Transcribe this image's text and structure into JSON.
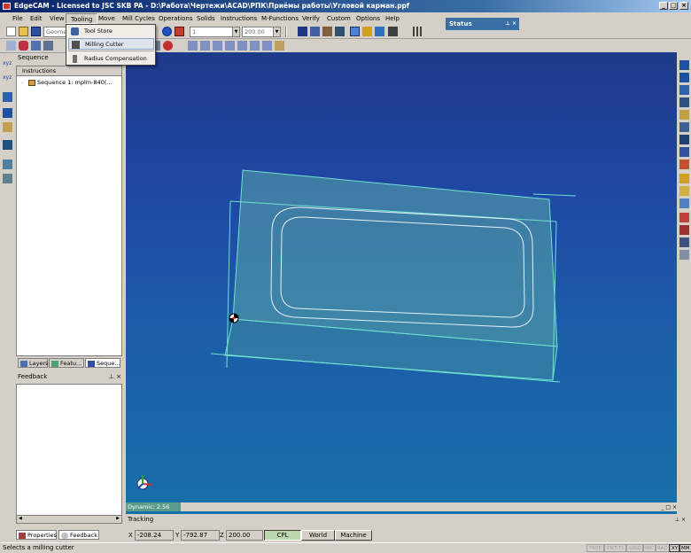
{
  "window": {
    "title": "EdgeCAM - Licensed to JSC SKB PA - D:\\Работа\\Чертежи\\ACAD\\РПК\\Приёмы работы\\Угловой карман.ppf"
  },
  "menu": [
    "File",
    "Edit",
    "View",
    "Tooling",
    "Move",
    "Mill Cycles",
    "Operations",
    "Solids",
    "Instructions",
    "M-Functions",
    "Verify",
    "Custom",
    "Options",
    "Help"
  ],
  "tooling_menu": {
    "items": [
      {
        "label": "Tool Store",
        "icon": "tool-store-icon"
      },
      {
        "label": "Milling Cutter",
        "icon": "milling-cutter-icon"
      },
      {
        "label": "Radius Compensation",
        "icon": "radius-compensation-icon"
      }
    ]
  },
  "toolbar": {
    "geometry_combo": "Geometr",
    "layer_combo": "1",
    "value_combo": "200.00"
  },
  "status_pane": {
    "title": "Status"
  },
  "sequence_panel": {
    "title": "Sequence",
    "column": "Instructions",
    "tree_item": "Sequence 1: mplm-840(...",
    "tabs": [
      "Layers",
      "Featu...",
      "Seque..."
    ]
  },
  "feedback_panel": {
    "title": "Feedback",
    "tabs": [
      "Properties",
      "Feedback"
    ]
  },
  "viewport": {
    "mode_label": "Dynamic: 2.56"
  },
  "tracking": {
    "label": "Tracking"
  },
  "coords": {
    "x_label": "X",
    "x": "-208.24",
    "y_label": "Y",
    "y": "-792.87",
    "z_label": "Z",
    "z": "200.00",
    "modes": [
      "CPL",
      "World",
      "Machine"
    ],
    "active_mode": "CPL"
  },
  "statusbar": {
    "message": "Selects a milling cutter",
    "indicators": [
      {
        "label": "FREE",
        "on": false
      },
      {
        "label": "ENTITY",
        "on": false
      },
      {
        "label": "GRID",
        "on": false
      },
      {
        "label": "INC",
        "on": false
      },
      {
        "label": "RAD",
        "on": false
      },
      {
        "label": "XY",
        "on": true
      },
      {
        "label": "MM",
        "on": true
      }
    ]
  },
  "colors": {
    "viewport_top": "#1e3a8a",
    "viewport_bottom": "#1670a8",
    "geometry": "#6fe0d0",
    "highlight": "#dde4ee"
  }
}
